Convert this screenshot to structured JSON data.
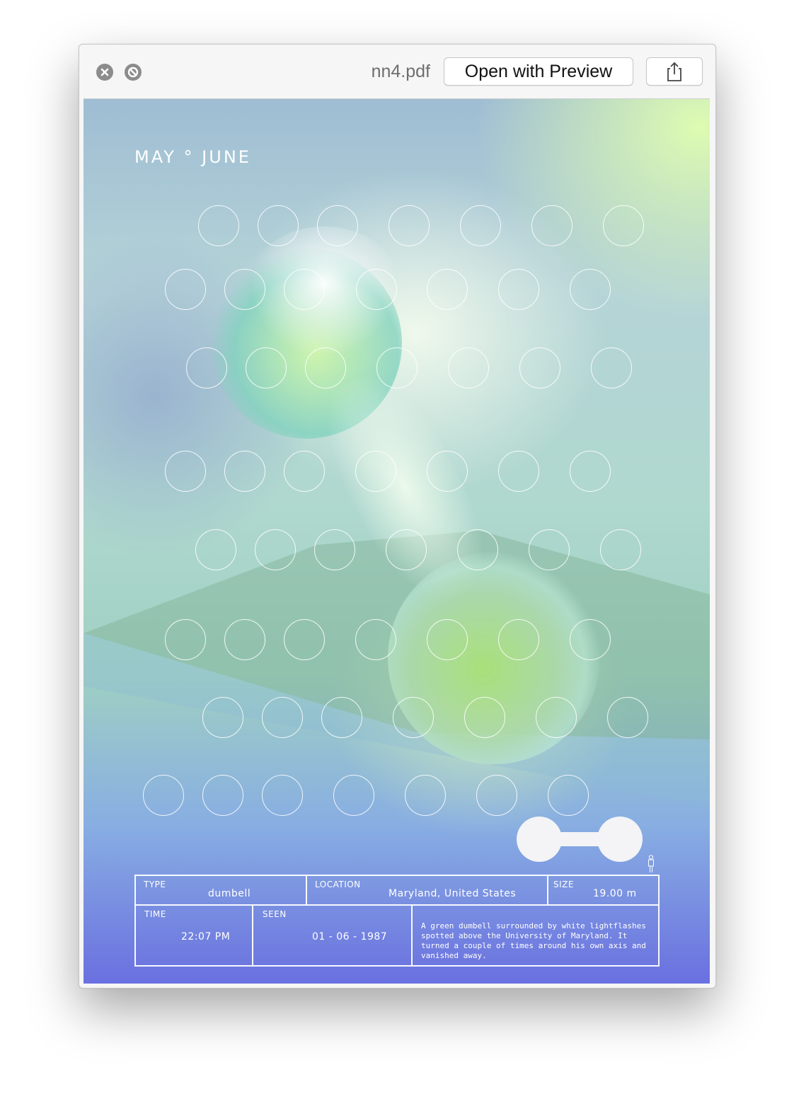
{
  "window": {
    "filename": "nn4.pdf",
    "open_button": "Open with Preview",
    "close_icon": "close-icon",
    "minimize_icon": "exit-fullscreen-icon",
    "share_icon": "share-icon"
  },
  "poster": {
    "heading": "MAY ° JUNE",
    "type_label": "TYPE",
    "type_value": "dumbell",
    "location_label": "LOCATION",
    "location_value": "Maryland, United States",
    "size_label": "SIZE",
    "size_value": "19.00 m",
    "time_label": "TIME",
    "time_value": "22:07 PM",
    "seen_label": "SEEN",
    "seen_value": "01 - 06 - 1987",
    "description": "A green dumbell surrounded by white lightflashes spotted above the University of Maryland. It turned a couple of times around his own axis and vanished away.",
    "scale_icon": "dumbbell-icon",
    "person_icon": "person-scale-icon"
  },
  "colors": {
    "accent_green": "#dcf9b4",
    "accent_blue": "#6a70e0"
  }
}
